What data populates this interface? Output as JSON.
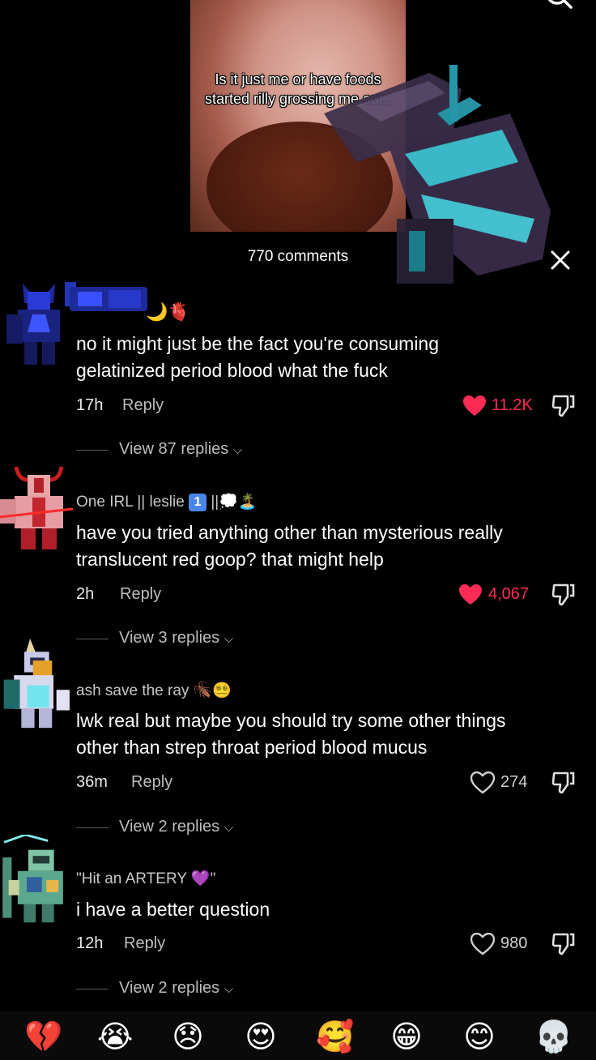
{
  "video": {
    "caption": "Is it just me or have foods started rilly grossing me out.."
  },
  "header": {
    "comments_count": "770 comments"
  },
  "comments": [
    {
      "username": "",
      "username_emoji": "🌙🫀",
      "text_line1": "no it might just be the fact you're consuming",
      "text_line2": "gelatinized period blood what the fuck",
      "time": "17h",
      "reply_label": "Reply",
      "likes": "11.2K",
      "liked": true,
      "view_replies": "View 87 replies"
    },
    {
      "username": "One IRL || leslie",
      "username_badge": "1",
      "username_suffix": "||💭🏝️",
      "text_line1": "have you tried anything other than mysterious really",
      "text_line2": "translucent red goop? that might help",
      "time": "2h",
      "reply_label": "Reply",
      "likes": "4,067",
      "liked": true,
      "view_replies": "View 3 replies"
    },
    {
      "username": "ash save the ray",
      "username_suffix": "🪳😵‍💫",
      "text_line1": "lwk real but maybe you should try some other things",
      "text_line2": "other than strep throat period blood mucus",
      "time": "36m",
      "reply_label": "Reply",
      "likes": "274",
      "liked": false,
      "view_replies": "View 2 replies"
    },
    {
      "username": "\"Hit an ARTERY 💜\"",
      "text_line1": "i have a better question",
      "time": "12h",
      "reply_label": "Reply",
      "likes": "980",
      "liked": false,
      "view_replies": "View 2 replies"
    }
  ],
  "emoji_bar": [
    "💔",
    "😭",
    "😞",
    "😍",
    "🥰",
    "😁",
    "😊",
    "💀"
  ],
  "colors": {
    "accent_like": "#fe2c55",
    "background": "#000000"
  }
}
